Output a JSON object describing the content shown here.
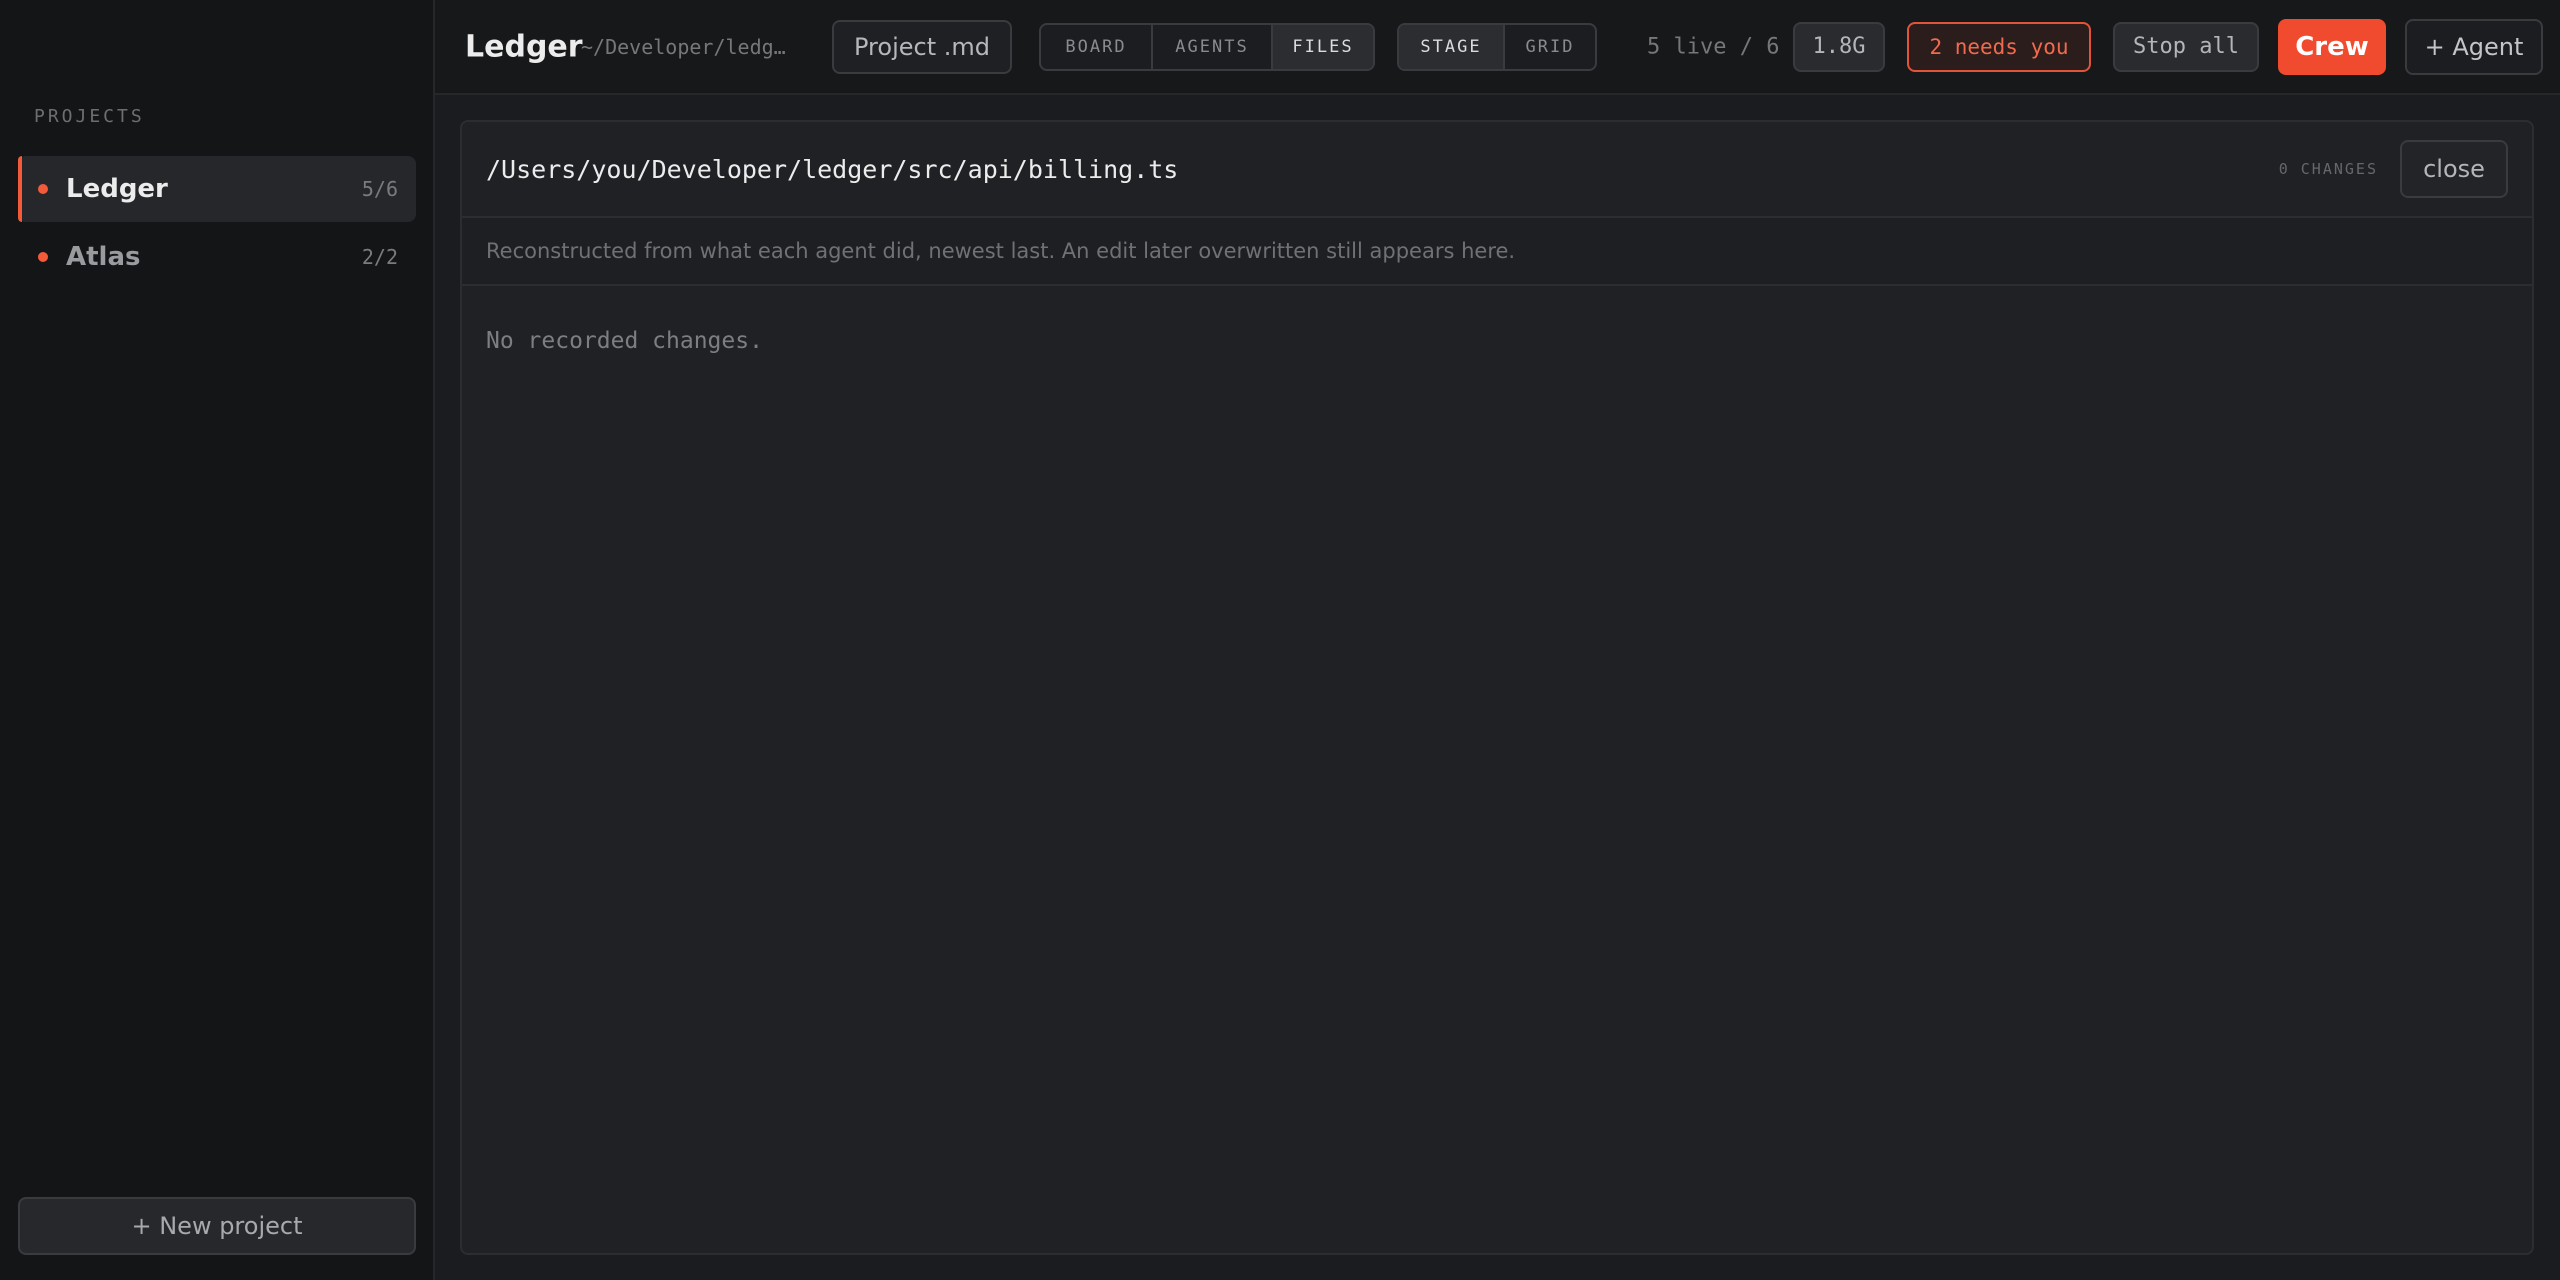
{
  "sidebar": {
    "heading": "PROJECTS",
    "projects": [
      {
        "name": "Ledger",
        "count": "5/6",
        "active": true
      },
      {
        "name": "Atlas",
        "count": "2/2",
        "active": false
      }
    ],
    "new_project_label": "+ New project"
  },
  "topbar": {
    "title": "Ledger",
    "path": "~/Developer/ledg…",
    "project_md_label": "Project .md",
    "view_tabs": [
      "BOARD",
      "AGENTS",
      "FILES"
    ],
    "active_view": "FILES",
    "layout_tabs": [
      "STAGE",
      "GRID"
    ],
    "active_layout": "STAGE",
    "live_count": "5 live / 6",
    "memory": "1.8G",
    "needs_you": "2 needs you",
    "stop_all_label": "Stop all",
    "crew_label": "Crew",
    "add_agent_label": "+ Agent"
  },
  "file_panel": {
    "path": "/Users/you/Developer/ledger/src/api/billing.ts",
    "changes_label": "0 CHANGES",
    "close_label": "close",
    "note": "Reconstructed from what each agent did, newest last. An edit later overwritten still appears here.",
    "empty_text": "No recorded changes."
  },
  "colors": {
    "accent": "#f04b2e",
    "background": "#1b1c1f",
    "sidebar_bg": "#141517"
  }
}
